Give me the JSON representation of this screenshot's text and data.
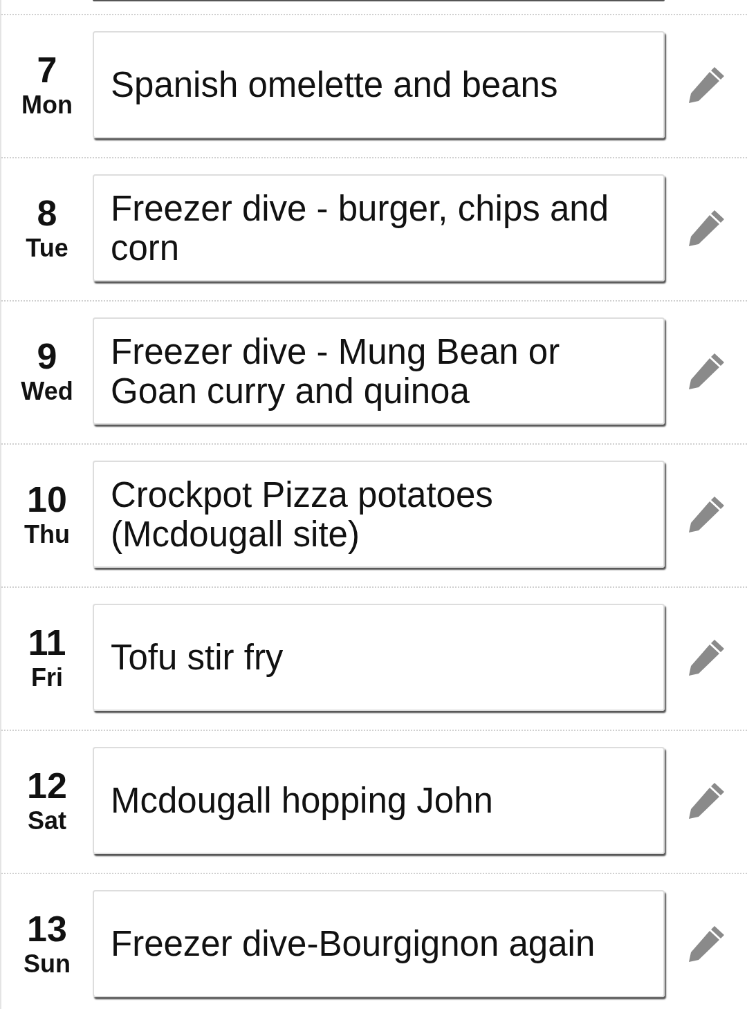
{
  "days": [
    {
      "date": "7",
      "weekday": "Mon",
      "meal": "Spanish omelette and beans"
    },
    {
      "date": "8",
      "weekday": "Tue",
      "meal": "Freezer dive - burger, chips and corn"
    },
    {
      "date": "9",
      "weekday": "Wed",
      "meal": "Freezer dive - Mung Bean or Goan curry and quinoa"
    },
    {
      "date": "10",
      "weekday": "Thu",
      "meal": "Crockpot Pizza potatoes (Mcdougall site)"
    },
    {
      "date": "11",
      "weekday": "Fri",
      "meal": "Tofu stir fry"
    },
    {
      "date": "12",
      "weekday": "Sat",
      "meal": "Mcdougall hopping John"
    },
    {
      "date": "13",
      "weekday": "Sun",
      "meal": "Freezer dive-Bourgignon again"
    }
  ]
}
